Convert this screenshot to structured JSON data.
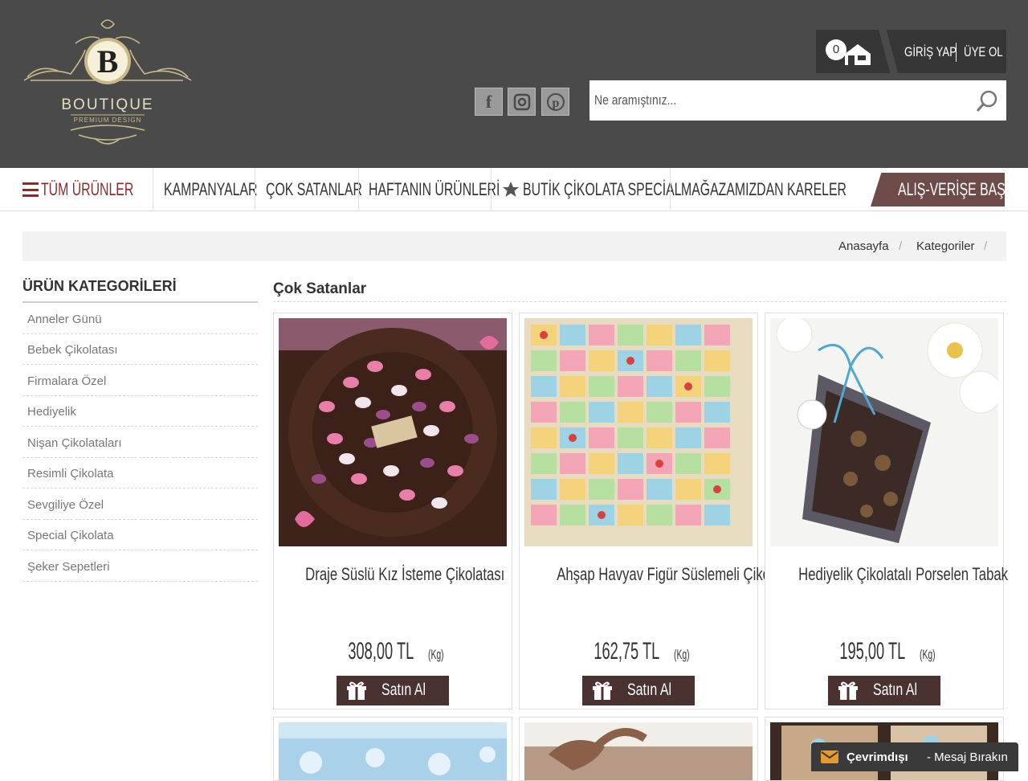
{
  "brand": {
    "name": "BOUTIQUE",
    "tagline": "PREMIUM DESIGN",
    "initial": "B"
  },
  "social": [
    {
      "name": "facebook",
      "glyph": "f"
    },
    {
      "name": "instagram",
      "glyph": "◘"
    },
    {
      "name": "pinterest",
      "glyph": "p"
    }
  ],
  "search": {
    "placeholder": "Ne aramıştınız..."
  },
  "account": {
    "cart_count": "0",
    "login": "GİRİŞ YAP",
    "register": "ÜYE OL"
  },
  "nav": {
    "all_products": "TÜM ÜRÜNLER",
    "items": [
      "KAMPANYALAR",
      "ÇOK SATANLAR",
      "HAFTANIN ÜRÜNLERİ",
      "BUTİK ÇİKOLATA SPECİAL",
      "MAĞAZAMIZDAN KARELER"
    ],
    "cta": "ALIŞ-VERİŞE BAŞLA"
  },
  "breadcrumb": {
    "items": [
      "Anasayfa",
      "Kategoriler"
    ],
    "separator": "/"
  },
  "sidebar": {
    "title": "ÜRÜN KATEGORİLERİ",
    "items": [
      "Anneler Günü",
      "Bebek Çikolatası",
      "Firmalara Özel",
      "Hediyelik",
      "Nişan Çikolataları",
      "Resimli Çikolata",
      "Sevgiliye Özel",
      "Special Çikolata",
      "Şeker Sepetleri"
    ]
  },
  "main": {
    "title": "Çok Satanlar",
    "products": [
      {
        "name": "Draje Süslü Kız İsteme Çikolatası",
        "price": "308,00 TL",
        "unit": "(Kg)",
        "button": "Satın Al"
      },
      {
        "name": "Ahşap Havyav Figür Süslemeli Çikolata",
        "price": "162,75 TL",
        "unit": "(Kg)",
        "button": "Satın Al"
      },
      {
        "name": "Hediyelik Çikolatalı Porselen Tabak",
        "price": "195,00 TL",
        "unit": "(Kg)",
        "button": "Satın Al"
      }
    ]
  },
  "chat": {
    "status": "Çevrimdışı",
    "action": "- Mesaj Bırakın"
  },
  "colors": {
    "header_bg": "#4a4a4a",
    "accent": "#8b2c2c",
    "cta_bg": "#6e4a48",
    "button_bg": "#4a3230",
    "gold": "#c9b98a"
  }
}
